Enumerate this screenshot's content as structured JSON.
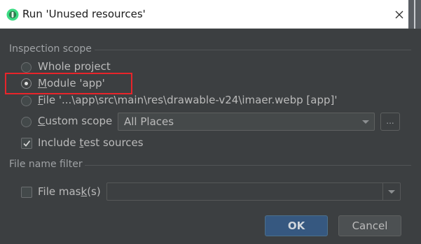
{
  "window": {
    "title": "Run 'Unused resources'",
    "icons": {
      "app": "android-studio-icon",
      "close": "close-icon"
    }
  },
  "inspection_scope": {
    "heading": "Inspection scope",
    "options": [
      {
        "id": "whole-project",
        "label": "Whole project",
        "selected": false
      },
      {
        "id": "module-app",
        "label_mnemonic": "M",
        "label_rest": "odule 'app'",
        "selected": true,
        "highlighted": true
      },
      {
        "id": "file",
        "label_mnemonic": "F",
        "label_rest": "ile '...\\app\\src\\main\\res\\drawable-v24\\imaer.webp [app]'",
        "selected": false
      },
      {
        "id": "custom-scope",
        "label_mnemonic": "C",
        "label_rest": "ustom scope",
        "selected": false
      }
    ],
    "custom_scope_value": "All Places",
    "browse_label": "...",
    "include_test_sources": {
      "label_pre": "Include ",
      "label_mnemonic": "t",
      "label_rest": "est sources",
      "checked": true
    }
  },
  "file_name_filter": {
    "heading": "File name filter",
    "file_mask": {
      "label_pre": "File mas",
      "label_mnemonic": "k",
      "label_rest": "(s)",
      "checked": false,
      "value": ""
    }
  },
  "buttons": {
    "ok": "OK",
    "cancel": "Cancel"
  },
  "colors": {
    "dialog_bg": "#3c3f41",
    "accent_ok": "#365880",
    "highlight_box": "#e8242a"
  }
}
